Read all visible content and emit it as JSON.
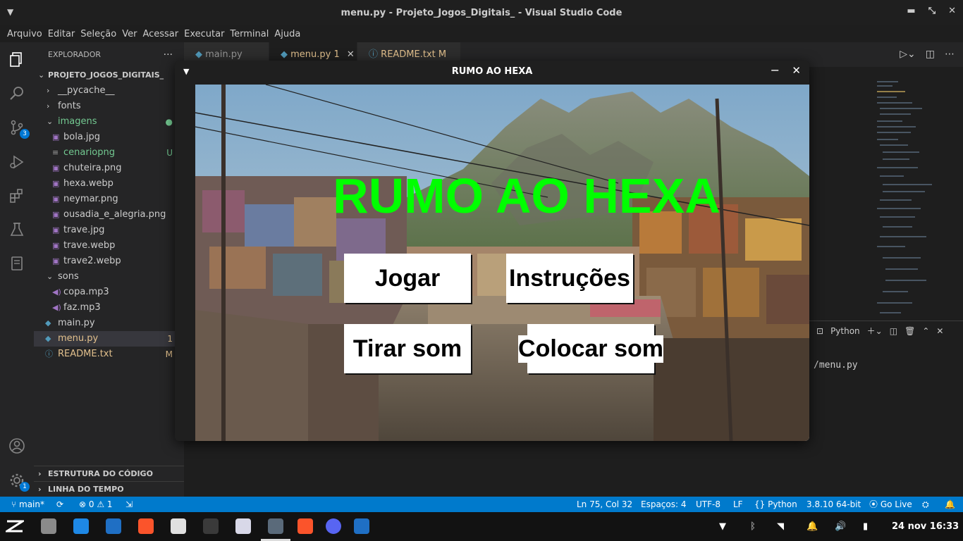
{
  "window": {
    "title": "menu.py - Projeto_Jogos_Digitais_ - Visual Studio Code"
  },
  "menu": [
    "Arquivo",
    "Editar",
    "Seleção",
    "Ver",
    "Acessar",
    "Executar",
    "Terminal",
    "Ajuda"
  ],
  "activity": {
    "scm_badge": "3",
    "settings_badge": "1"
  },
  "explorer": {
    "title": "EXPLORADOR",
    "more": "...",
    "project": "PROJETO_JOGOS_DIGITAIS_",
    "items": [
      {
        "label": "__pycache__",
        "type": "folder",
        "status": ""
      },
      {
        "label": "fonts",
        "type": "folder",
        "status": ""
      },
      {
        "label": "imagens",
        "type": "folder-open",
        "status": ""
      },
      {
        "label": "bola.jpg",
        "type": "image",
        "status": ""
      },
      {
        "label": "cenariopng",
        "type": "file",
        "status": "U"
      },
      {
        "label": "chuteira.png",
        "type": "image",
        "status": ""
      },
      {
        "label": "hexa.webp",
        "type": "image",
        "status": ""
      },
      {
        "label": "neymar.png",
        "type": "image",
        "status": ""
      },
      {
        "label": "ousadia_e_alegria.png",
        "type": "image",
        "status": ""
      },
      {
        "label": "trave.jpg",
        "type": "image",
        "status": ""
      },
      {
        "label": "trave.webp",
        "type": "image",
        "status": ""
      },
      {
        "label": "trave2.webp",
        "type": "image",
        "status": ""
      },
      {
        "label": "sons",
        "type": "folder-open",
        "status": ""
      },
      {
        "label": "copa.mp3",
        "type": "audio",
        "status": ""
      },
      {
        "label": "faz.mp3",
        "type": "audio",
        "status": ""
      },
      {
        "label": "main.py",
        "type": "python",
        "status": ""
      },
      {
        "label": "menu.py",
        "type": "python",
        "status": "1"
      },
      {
        "label": "README.txt",
        "type": "info",
        "status": "M"
      }
    ],
    "outline": "ESTRUTURA DO CÓDIGO",
    "timeline": "LINHA DO TEMPO"
  },
  "tabs": [
    {
      "label": "main.py",
      "badge": ""
    },
    {
      "label": "menu.py",
      "badge": "1"
    },
    {
      "label": "README.txt",
      "badge": "M"
    }
  ],
  "terminal": {
    "shell": "Python",
    "text": "/menu.py"
  },
  "game": {
    "window_title": "RUMO AO HEXA",
    "title": "RUMO AO HEXA",
    "buttons": {
      "play": "Jogar",
      "instructions": "Instruções",
      "mute": "Tirar som",
      "unmute": "Colocar som"
    },
    "title_color": "#00ff00"
  },
  "status": {
    "branch": "main*",
    "errors": "0",
    "warnings": "1",
    "position": "Ln 75, Col 32",
    "spaces": "Espaços: 4",
    "encoding": "UTF-8",
    "eol": "LF",
    "language": "Python",
    "interpreter": "3.8.10 64-bit",
    "live": "Go Live"
  },
  "taskbar": {
    "datetime": "24 nov 16:33"
  },
  "colors": {
    "accent": "#007acc",
    "modified": "#e2c08d",
    "untracked": "#73c991",
    "folder_chevron": "#cccccc"
  }
}
